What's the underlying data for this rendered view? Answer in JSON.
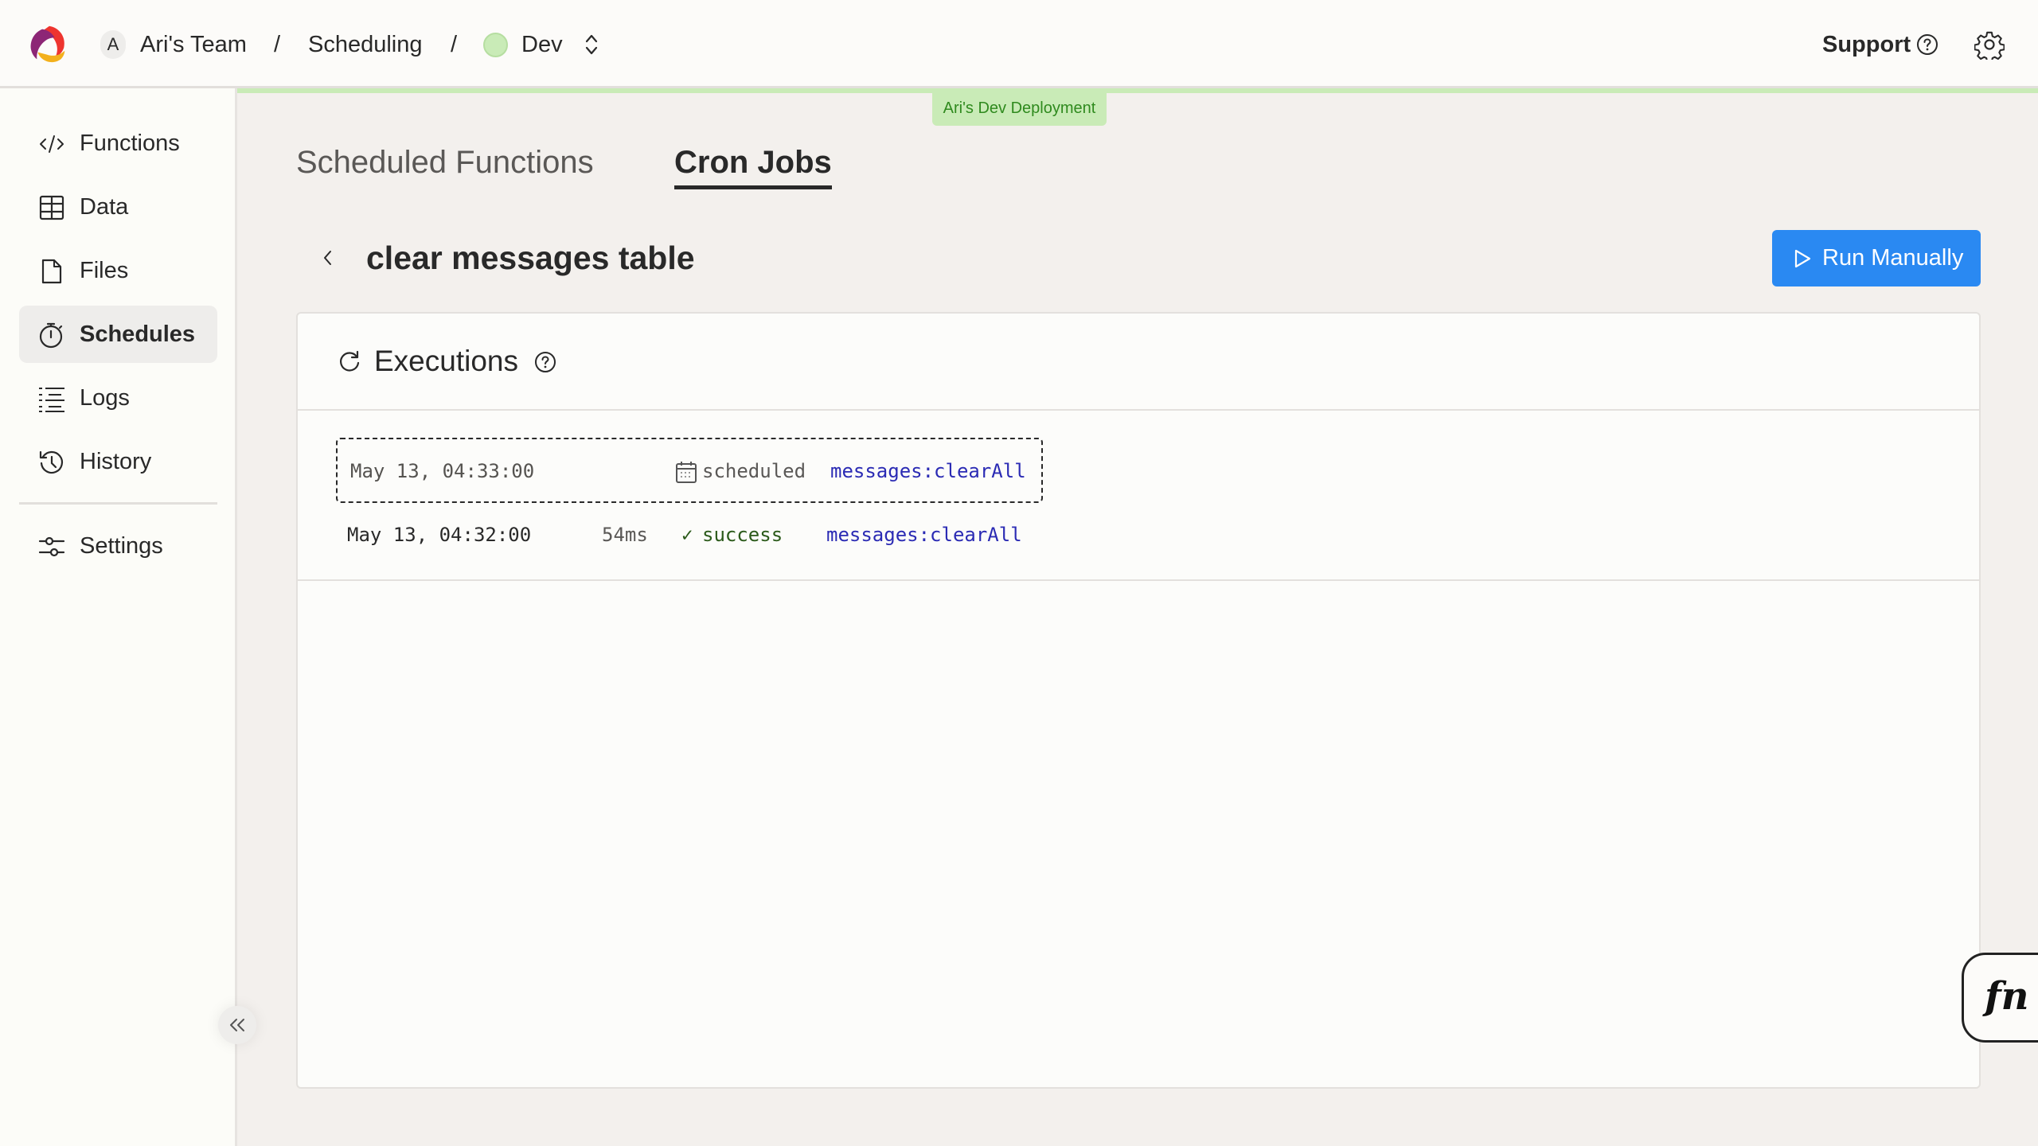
{
  "header": {
    "logo": "convex-logo",
    "team_avatar_initial": "A",
    "team_name": "Ari's Team",
    "separator": "/",
    "project_name": "Scheduling",
    "deployment_name": "Dev",
    "deployment_color": "#c9ebb7",
    "support_label": "Support",
    "support_icon": "question-circle-icon",
    "settings_icon": "gear-icon"
  },
  "deployment_banner": {
    "label": "Ari's Dev Deployment",
    "color": "#c9ebb7"
  },
  "sidebar": {
    "items": [
      {
        "label": "Functions",
        "icon": "code-icon",
        "active": false
      },
      {
        "label": "Data",
        "icon": "table-icon",
        "active": false
      },
      {
        "label": "Files",
        "icon": "file-icon",
        "active": false
      },
      {
        "label": "Schedules",
        "icon": "stopwatch-icon",
        "active": true
      },
      {
        "label": "Logs",
        "icon": "logs-icon",
        "active": false
      },
      {
        "label": "History",
        "icon": "history-icon",
        "active": false
      },
      {
        "label": "Settings",
        "icon": "sliders-icon",
        "active": false
      }
    ],
    "collapse_icon": "double-chevron-left-icon"
  },
  "main": {
    "tabs": [
      {
        "label": "Scheduled Functions",
        "active": false
      },
      {
        "label": "Cron Jobs",
        "active": true
      }
    ],
    "page_title": "clear messages table",
    "run_button": {
      "label": "Run Manually",
      "color": "#2a89f2"
    },
    "executions": {
      "title": "Executions",
      "rows": [
        {
          "time": "May 13, 04:33:00",
          "duration": "",
          "status": "scheduled",
          "function": "messages:clearAll"
        },
        {
          "time": "May 13, 04:32:00",
          "duration": "54ms",
          "status_mark": "✓",
          "status": "success",
          "function": "messages:clearAll"
        }
      ]
    }
  },
  "fn_button": {
    "label": "fn"
  }
}
